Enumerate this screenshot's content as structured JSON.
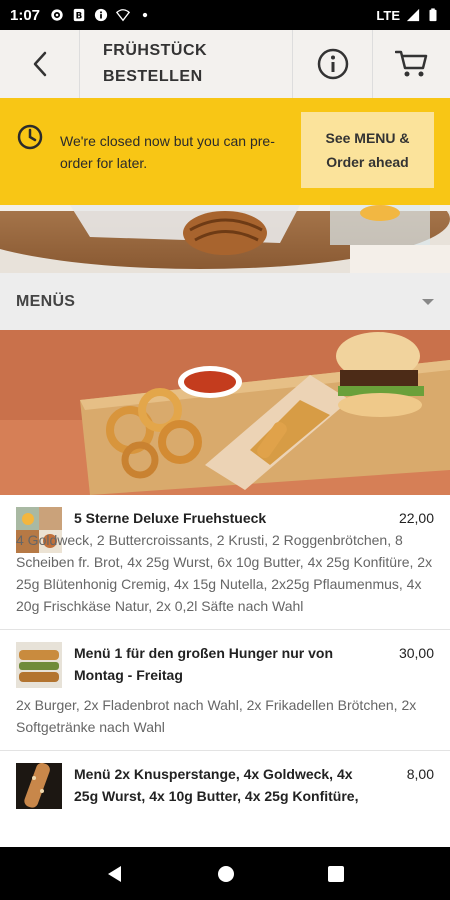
{
  "status_bar": {
    "time": "1:07",
    "network": "LTE",
    "icons": [
      "settings-icon",
      "b-icon",
      "info-icon",
      "wifi-off-icon",
      "dot-icon",
      "signal-icon",
      "battery-icon"
    ]
  },
  "header": {
    "title_line1": "FRÜHSTÜCK",
    "title_line2": "BESTELLEN",
    "back_icon": "back-arrow-icon",
    "info_icon": "info-icon",
    "cart_icon": "cart-icon"
  },
  "notice": {
    "text": "We're closed now but you can pre-order for later.",
    "button_line1": "See MENU &",
    "button_line2": "Order ahead",
    "color": "#f8c615"
  },
  "section": {
    "title": "MENÜS"
  },
  "items": [
    {
      "name": "5 Sterne Deluxe Fruehstueck",
      "price": "22,00",
      "desc": "4 Goldweck, 2 Buttercroissants, 2 Krusti, 2 Roggenbrötchen, 8 Scheiben fr. Brot, 4x 25g Wurst, 6x 10g Butter, 4x 25g Konfitüre, 2x 25g Blütenhonig Cremig, 4x 15g Nutella, 2x25g Pflaumenmus, 4x 20g Frischkäse Natur, 2x 0,2l Säfte nach Wahl"
    },
    {
      "name": "Menü 1 für den großen Hunger nur von Montag - Freitag",
      "price": "30,00",
      "desc": "2x Burger, 2x Fladenbrot nach Wahl, 2x Frikadellen Brötchen, 2x Softgetränke nach Wahl"
    },
    {
      "name": "Menü 2x Knusperstange, 4x Goldweck, 4x 25g Wurst, 4x 10g Butter, 4x 25g Konfitüre,",
      "price": "8,00",
      "desc": ""
    }
  ],
  "navbar": {
    "icons": [
      "nav-back-icon",
      "nav-home-icon",
      "nav-recents-icon"
    ]
  }
}
